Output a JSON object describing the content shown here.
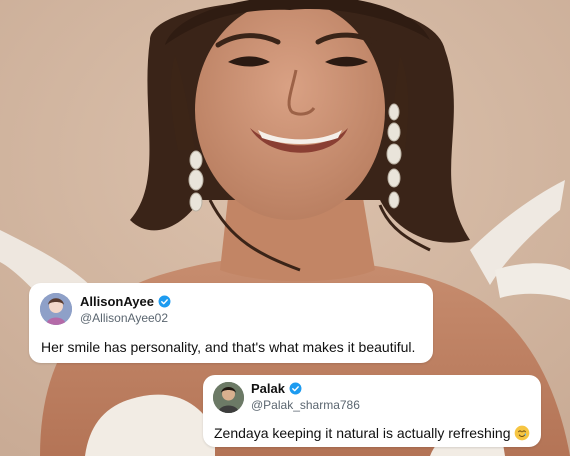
{
  "tweets": [
    {
      "display_name": "AllisonAyee",
      "handle": "@AllisonAyee02",
      "text": "Her smile has personality, and that's what makes it beautiful.",
      "verified": true
    },
    {
      "display_name": "Palak",
      "handle": "@Palak_sharma786",
      "text": "Zendaya keeping it natural is actually refreshing",
      "verified": true,
      "emoji": "smiling-tear-emoji"
    }
  ],
  "colors": {
    "background": "#d7bca7",
    "verified_badge": "#1d9bf0",
    "card": "#ffffff"
  }
}
